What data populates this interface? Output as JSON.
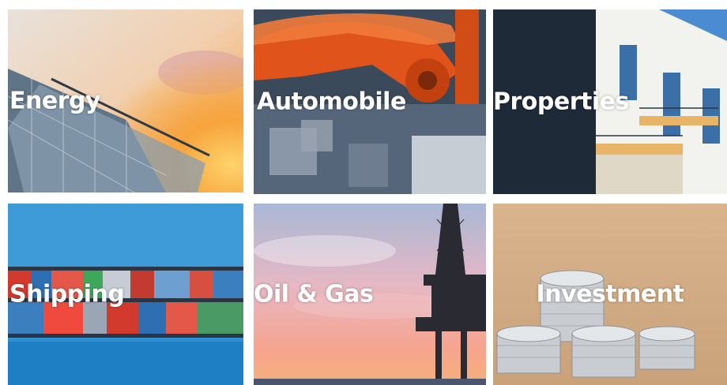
{
  "tiles": [
    {
      "label": "Energy",
      "scene": "solar-panels-sunset"
    },
    {
      "label": "Automobile",
      "scene": "industrial-robot-arm"
    },
    {
      "label": "Properties",
      "scene": "apartment-building"
    },
    {
      "label": "Shipping",
      "scene": "container-ship-aerial"
    },
    {
      "label": "Oil & Gas",
      "scene": "offshore-oil-rig-pink-sky"
    },
    {
      "label": "Investment",
      "scene": "stacked-coins"
    }
  ]
}
